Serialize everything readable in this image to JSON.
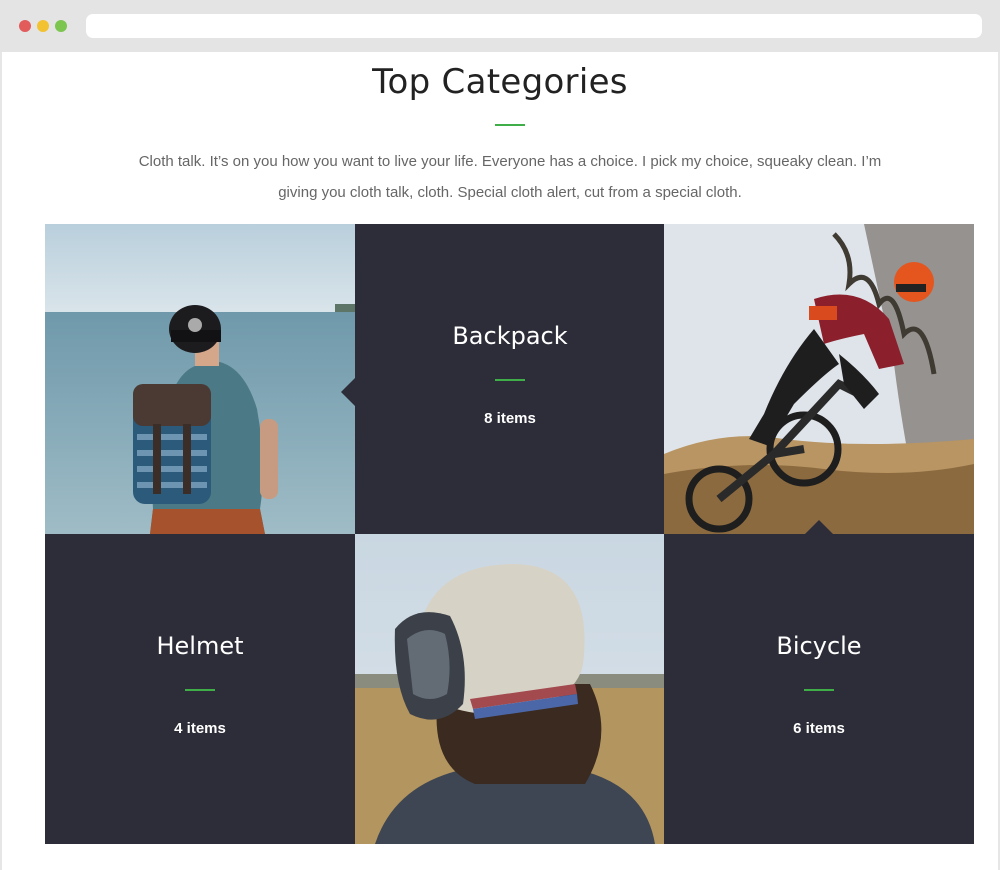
{
  "section": {
    "title": "Top Categories",
    "intro": "Cloth talk. It’s on you how you want to live your life. Everyone has a choice. I pick my choice, squeaky clean. I’m giving you cloth talk, cloth. Special cloth alert, cut from a special cloth."
  },
  "categories": [
    {
      "name": "Backpack",
      "count": "8 items"
    },
    {
      "name": "Helmet",
      "count": "4 items"
    },
    {
      "name": "Bicycle",
      "count": "6 items"
    }
  ],
  "colors": {
    "accent": "#3fae49",
    "tile_dark": "#2d2d39"
  }
}
